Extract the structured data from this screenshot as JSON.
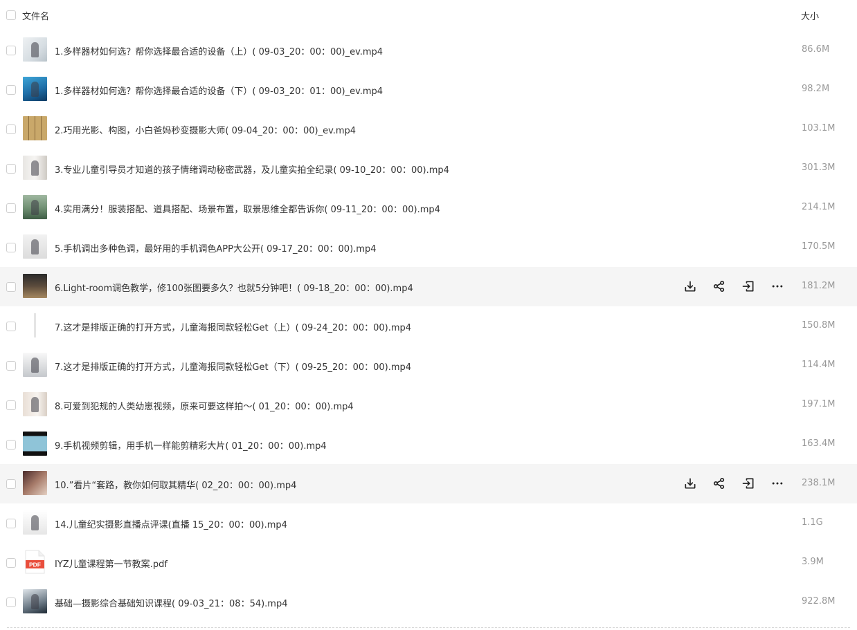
{
  "header": {
    "name_label": "文件名",
    "size_label": "大小"
  },
  "files": [
    {
      "name": "1.多样器材如何选？帮你选择最合适的设备（上）( 09-03_20：00：00)_ev.mp4",
      "size": "86.6M",
      "thumb": "t-light",
      "figure": true
    },
    {
      "name": "1.多样器材如何选？帮你选择最合适的设备（下）( 09-03_20：01：00)_ev.mp4",
      "size": "98.2M",
      "thumb": "t-blue",
      "figure": true
    },
    {
      "name": "2.巧用光影、构图，小白爸妈秒变摄影大师( 09-04_20：00：00)_ev.mp4",
      "size": "103.1M",
      "thumb": "t-grid",
      "figure": false
    },
    {
      "name": "3.专业儿童引导员才知道的孩子情绪调动秘密武器，及儿童实拍全纪录( 09-10_20：00：00).mp4",
      "size": "301.3M",
      "thumb": "t-room",
      "figure": true
    },
    {
      "name": "4.实用满分！服装搭配、道具搭配、场景布置，取景思维全都告诉你( 09-11_20：00：00).mp4",
      "size": "214.1M",
      "thumb": "t-park",
      "figure": true
    },
    {
      "name": "5.手机调出多种色调，最好用的手机调色APP大公开( 09-17_20：00：00).mp4",
      "size": "170.5M",
      "thumb": "t-white",
      "figure": true
    },
    {
      "name": "6.Light-room调色教学，修100张图要多久？也就5分钟吧！( 09-18_20：00：00).mp4",
      "size": "181.2M",
      "thumb": "t-dark",
      "figure": false
    },
    {
      "name": "7.这才是排版正确的打开方式，儿童海报同款轻松Get（上）( 09-24_20：00：00).mp4",
      "size": "150.8M",
      "thumb": "t-collage",
      "figure": false
    },
    {
      "name": "7.这才是排版正确的打开方式，儿童海报同款轻松Get（下）( 09-25_20：00：00).mp4",
      "size": "114.4M",
      "thumb": "t-poster",
      "figure": true
    },
    {
      "name": "8.可爱到犯规的人类幼崽视频，原来可要这样拍～( 01_20：00：00).mp4",
      "size": "197.1M",
      "thumb": "t-baby",
      "figure": true
    },
    {
      "name": "9.手机视频剪辑，用手机一样能剪精彩大片( 01_20：00：00).mp4",
      "size": "163.4M",
      "thumb": "t-video",
      "figure": false
    },
    {
      "name": "10.”看片“套路，教你如何取其精华( 02_20：00：00).mp4",
      "size": "238.1M",
      "thumb": "t-mix",
      "figure": false
    },
    {
      "name": "14.儿童纪实摄影直播点评课(直播 15_20：00：00).mp4",
      "size": "1.1G",
      "thumb": "t-photo",
      "figure": true
    },
    {
      "name": "IYZ儿童课程第一节教案.pdf",
      "size": "3.9M",
      "thumb": "t-pdf",
      "figure": false,
      "pdf_label": "PDF"
    },
    {
      "name": "基础—摄影综合基础知识课程( 09-03_21：08：54).mp4",
      "size": "922.8M",
      "thumb": "t-man",
      "figure": true
    }
  ],
  "hovered_rows": [
    6,
    11
  ],
  "action_icons": [
    "download-icon",
    "share-icon",
    "move-icon",
    "more-icon"
  ],
  "colors": {
    "hover_bg": "#f5f5f5",
    "size_text": "#999999",
    "name_text": "#333333"
  }
}
